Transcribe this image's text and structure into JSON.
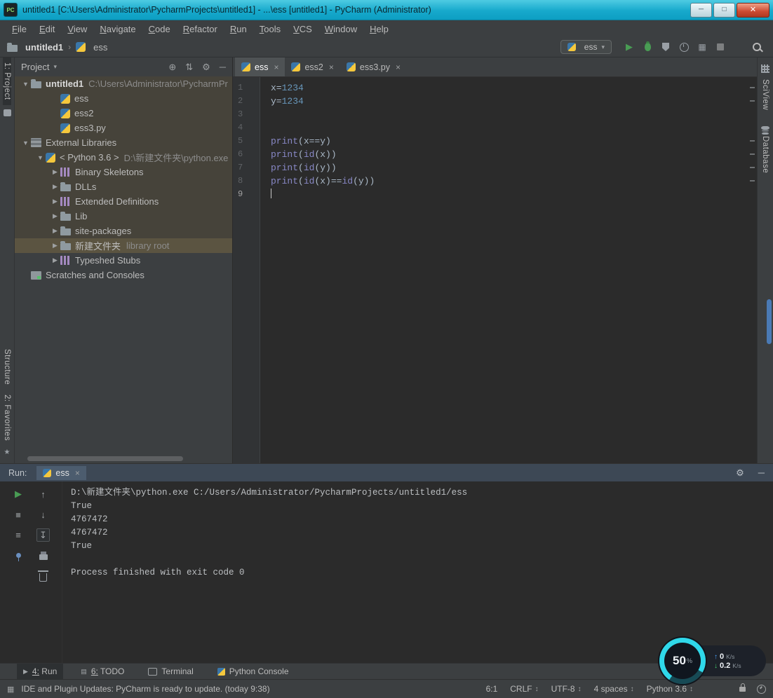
{
  "window": {
    "title": "untitled1 [C:\\Users\\Administrator\\PycharmProjects\\untitled1] - ...\\ess [untitled1] - PyCharm (Administrator)",
    "app_icon_label": "PC",
    "controls": {
      "min": "─",
      "max": "□",
      "close": "✕"
    }
  },
  "icons": {
    "locate": "⊕",
    "collapse": "⇅",
    "settings": "⚙",
    "hide": "─",
    "close": "×",
    "dropdown": "▾",
    "run": "▶",
    "stop": "■",
    "up": "↑",
    "down": "↓",
    "soft_wrap": "≡",
    "scroll_end": "↧",
    "chevrons": "↕",
    "todo": "▤",
    "toggle": "▦"
  },
  "menu": {
    "items": [
      "File",
      "Edit",
      "View",
      "Navigate",
      "Code",
      "Refactor",
      "Run",
      "Tools",
      "VCS",
      "Window",
      "Help"
    ]
  },
  "navbar": {
    "separator": "›",
    "crumbs": [
      {
        "label": "untitled1",
        "icon": "folder",
        "bold": true
      },
      {
        "label": "ess",
        "icon": "py",
        "bold": false
      }
    ],
    "run_config": {
      "value": "ess"
    }
  },
  "project": {
    "title": "Project",
    "warm_rows": 12,
    "tree": [
      {
        "name": "untitled1",
        "indent": 0,
        "arrow": "▼",
        "icon": "folder",
        "label": "untitled1",
        "bold": true,
        "path": "C:\\Users\\Administrator\\PycharmPr"
      },
      {
        "name": "ess",
        "indent": 2,
        "icon": "py",
        "label": "ess"
      },
      {
        "name": "ess2",
        "indent": 2,
        "icon": "py",
        "label": "ess2"
      },
      {
        "name": "ess3-py",
        "indent": 2,
        "icon": "py",
        "label": "ess3.py"
      },
      {
        "name": "external-libraries",
        "indent": 0,
        "arrow": "▼",
        "icon": "libs",
        "label": "External Libraries"
      },
      {
        "name": "python-3-6",
        "indent": 1,
        "arrow": "▼",
        "icon": "py",
        "label": "< Python 3.6 >",
        "path": "D:\\新建文件夹\\python.exe"
      },
      {
        "name": "binary-skeletons",
        "indent": 2,
        "arrow": "▶",
        "icon": "cols",
        "label": "Binary Skeletons"
      },
      {
        "name": "dlls",
        "indent": 2,
        "arrow": "▶",
        "icon": "folder",
        "label": "DLLs"
      },
      {
        "name": "extended-definitions",
        "indent": 2,
        "arrow": "▶",
        "icon": "cols",
        "label": "Extended Definitions"
      },
      {
        "name": "lib",
        "indent": 2,
        "arrow": "▶",
        "icon": "folder",
        "label": "Lib"
      },
      {
        "name": "site-packages",
        "indent": 2,
        "arrow": "▶",
        "icon": "folder",
        "label": "site-packages"
      },
      {
        "name": "xinjian-wenjianjia",
        "indent": 2,
        "arrow": "▶",
        "icon": "folder",
        "label": "新建文件夹",
        "suffix": "library root",
        "selected": true
      },
      {
        "name": "typeshed-stubs",
        "indent": 2,
        "arrow": "▶",
        "icon": "cols",
        "label": "Typeshed Stubs"
      },
      {
        "name": "scratches-and-consoles",
        "indent": 0,
        "icon": "scratch",
        "label": "Scratches and Consoles"
      }
    ]
  },
  "editor": {
    "tabs": [
      {
        "label": "ess",
        "active": true
      },
      {
        "label": "ess2",
        "active": false
      },
      {
        "label": "ess3.py",
        "active": false
      }
    ],
    "cursor_line": 9,
    "lines": [
      {
        "num": 1,
        "tokens": [
          {
            "t": "plain",
            "v": "x="
          },
          {
            "t": "number",
            "v": "1234"
          }
        ]
      },
      {
        "num": 2,
        "tokens": [
          {
            "t": "plain",
            "v": "y="
          },
          {
            "t": "number",
            "v": "1234"
          }
        ]
      },
      {
        "num": 3,
        "tokens": []
      },
      {
        "num": 4,
        "tokens": []
      },
      {
        "num": 5,
        "tokens": [
          {
            "t": "builtin",
            "v": "print"
          },
          {
            "t": "plain",
            "v": "(x==y)"
          }
        ]
      },
      {
        "num": 6,
        "tokens": [
          {
            "t": "builtin",
            "v": "print"
          },
          {
            "t": "plain",
            "v": "("
          },
          {
            "t": "builtin",
            "v": "id"
          },
          {
            "t": "plain",
            "v": "(x))"
          }
        ]
      },
      {
        "num": 7,
        "tokens": [
          {
            "t": "builtin",
            "v": "print"
          },
          {
            "t": "plain",
            "v": "("
          },
          {
            "t": "builtin",
            "v": "id"
          },
          {
            "t": "plain",
            "v": "(y))"
          }
        ]
      },
      {
        "num": 8,
        "tokens": [
          {
            "t": "builtin",
            "v": "print"
          },
          {
            "t": "plain",
            "v": "("
          },
          {
            "t": "builtin",
            "v": "id"
          },
          {
            "t": "plain",
            "v": "(x)=="
          },
          {
            "t": "builtin",
            "v": "id"
          },
          {
            "t": "plain",
            "v": "(y))"
          }
        ]
      },
      {
        "num": 9,
        "tokens": []
      }
    ]
  },
  "run_panel": {
    "label": "Run:",
    "tab": "ess",
    "console": [
      "D:\\新建文件夹\\python.exe C:/Users/Administrator/PycharmProjects/untitled1/ess",
      "True",
      "4767472",
      "4767472",
      "True",
      "",
      "Process finished with exit code 0"
    ]
  },
  "tool_windows": {
    "left_top": "1: Project",
    "left_bottom": [
      "Structure",
      "2: Favorites"
    ],
    "right": [
      "SciView",
      "Database"
    ],
    "bottom": [
      {
        "label": "4: Run",
        "icon": "run",
        "active": true,
        "mnemonic": true
      },
      {
        "label": "6: TODO",
        "icon": "todo",
        "active": false,
        "mnemonic": true
      },
      {
        "label": "Terminal",
        "icon": "terminal",
        "active": false,
        "mnemonic": false
      },
      {
        "label": "Python Console",
        "icon": "python",
        "active": false,
        "mnemonic": false
      }
    ]
  },
  "status_bar": {
    "message": "IDE and Plugin Updates: PyCharm is ready to update. (today 9:38)",
    "items": [
      {
        "label": "6:1",
        "chevron": false
      },
      {
        "label": "CRLF",
        "chevron": true
      },
      {
        "label": "UTF-8",
        "chevron": true
      },
      {
        "label": "4 spaces",
        "chevron": true
      },
      {
        "label": "Python 3.6",
        "chevron": true
      }
    ]
  },
  "net_widget": {
    "percent": "50",
    "percent_sign": "%",
    "up_value": "0",
    "up_unit": "K/s",
    "down_value": "0.2",
    "down_unit": "K/s"
  }
}
